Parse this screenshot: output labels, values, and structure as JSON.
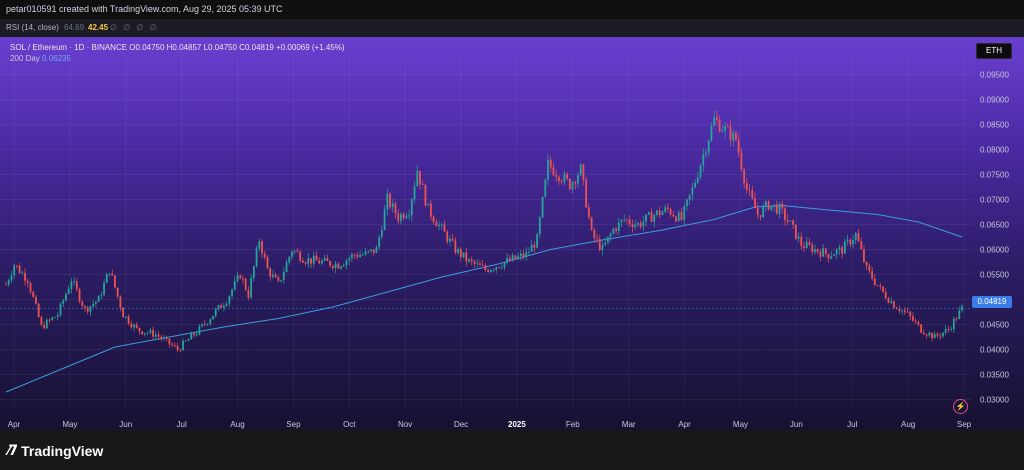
{
  "header": {
    "caption": "petar010591 created with TradingView.com, Aug 29, 2025 05:39 UTC"
  },
  "rsi": {
    "label": "RSI (14, close)",
    "value1": "64.69",
    "value2": "42.45",
    "placeholders": "∅ ∅ ∅ ∅"
  },
  "legend": {
    "symbol_line": "SOL / Ethereum · 1D · BINANCE  O0.04750  H0.04857  L0.04750  C0.04819  +0.00069 (+1.45%)",
    "ma_label": "200 Day",
    "ma_value": "0.06235"
  },
  "currency_badge": "ETH",
  "last_price_label": "0.04819",
  "footer": {
    "logo_text": "TradingView",
    "logo_icon": "tradingview-logo-icon"
  },
  "icons": {
    "bolt": "lightning-icon"
  },
  "colors": {
    "up": "#26a69a",
    "down": "#ef5350",
    "ma": "#3d9cde",
    "accent": "#3b7de8"
  },
  "chart_data": {
    "type": "candlestick",
    "title": "",
    "xlabel": "",
    "ylabel": "",
    "ylim": [
      0.0285,
      0.0985
    ],
    "y_ticks": [
      "0.03000",
      "0.03500",
      "0.04000",
      "0.04500",
      "0.05000",
      "0.05500",
      "0.06000",
      "0.06500",
      "0.07000",
      "0.07500",
      "0.08000",
      "0.08500",
      "0.09000",
      "0.09500"
    ],
    "x_ticks": [
      "Apr",
      "May",
      "Jun",
      "Jul",
      "Aug",
      "Sep",
      "Oct",
      "Nov",
      "Dec",
      "2025",
      "Feb",
      "Mar",
      "Apr",
      "May",
      "Jun",
      "Jul",
      "Aug",
      "Sep"
    ],
    "price_path": [
      [
        0,
        0.053
      ],
      [
        3,
        0.057
      ],
      [
        8,
        0.054
      ],
      [
        13,
        0.0445
      ],
      [
        19,
        0.047
      ],
      [
        24,
        0.054
      ],
      [
        29,
        0.048
      ],
      [
        34,
        0.05
      ],
      [
        38,
        0.056
      ],
      [
        43,
        0.047
      ],
      [
        48,
        0.044
      ],
      [
        55,
        0.043
      ],
      [
        59,
        0.0415
      ],
      [
        63,
        0.04
      ],
      [
        67,
        0.042
      ],
      [
        71,
        0.044
      ],
      [
        76,
        0.047
      ],
      [
        81,
        0.05
      ],
      [
        86,
        0.055
      ],
      [
        89,
        0.051
      ],
      [
        93,
        0.062
      ],
      [
        96,
        0.056
      ],
      [
        100,
        0.053
      ],
      [
        105,
        0.06
      ],
      [
        110,
        0.058
      ],
      [
        116,
        0.0575
      ],
      [
        122,
        0.057
      ],
      [
        128,
        0.059
      ],
      [
        132,
        0.059
      ],
      [
        136,
        0.06
      ],
      [
        140,
        0.07
      ],
      [
        144,
        0.0665
      ],
      [
        148,
        0.068
      ],
      [
        151,
        0.076
      ],
      [
        155,
        0.068
      ],
      [
        160,
        0.064
      ],
      [
        165,
        0.06
      ],
      [
        170,
        0.0575
      ],
      [
        176,
        0.056
      ],
      [
        181,
        0.057
      ],
      [
        186,
        0.058
      ],
      [
        191,
        0.059
      ],
      [
        195,
        0.062
      ],
      [
        199,
        0.077
      ],
      [
        203,
        0.075
      ],
      [
        207,
        0.073
      ],
      [
        211,
        0.076
      ],
      [
        215,
        0.063
      ],
      [
        219,
        0.06
      ],
      [
        223,
        0.064
      ],
      [
        227,
        0.066
      ],
      [
        232,
        0.065
      ],
      [
        238,
        0.067
      ],
      [
        243,
        0.068
      ],
      [
        248,
        0.066
      ],
      [
        252,
        0.072
      ],
      [
        256,
        0.079
      ],
      [
        260,
        0.086
      ],
      [
        264,
        0.084
      ],
      [
        268,
        0.082
      ],
      [
        272,
        0.072
      ],
      [
        276,
        0.067
      ],
      [
        280,
        0.069
      ],
      [
        284,
        0.068
      ],
      [
        288,
        0.065
      ],
      [
        292,
        0.061
      ],
      [
        297,
        0.06
      ],
      [
        302,
        0.059
      ],
      [
        307,
        0.06
      ],
      [
        312,
        0.063
      ],
      [
        316,
        0.056
      ],
      [
        321,
        0.052
      ],
      [
        326,
        0.049
      ],
      [
        331,
        0.047
      ],
      [
        336,
        0.044
      ],
      [
        341,
        0.0425
      ],
      [
        346,
        0.044
      ],
      [
        351,
        0.0482
      ]
    ],
    "ma200": [
      [
        0,
        0.0315
      ],
      [
        20,
        0.036
      ],
      [
        40,
        0.0405
      ],
      [
        60,
        0.0425
      ],
      [
        80,
        0.0445
      ],
      [
        100,
        0.0462
      ],
      [
        120,
        0.0485
      ],
      [
        140,
        0.0515
      ],
      [
        160,
        0.0545
      ],
      [
        180,
        0.057
      ],
      [
        200,
        0.06
      ],
      [
        220,
        0.062
      ],
      [
        240,
        0.0638
      ],
      [
        260,
        0.066
      ],
      [
        275,
        0.0685
      ],
      [
        285,
        0.0688
      ],
      [
        300,
        0.068
      ],
      [
        320,
        0.067
      ],
      [
        335,
        0.0655
      ],
      [
        351,
        0.0625
      ]
    ],
    "last_price": 0.04819
  }
}
